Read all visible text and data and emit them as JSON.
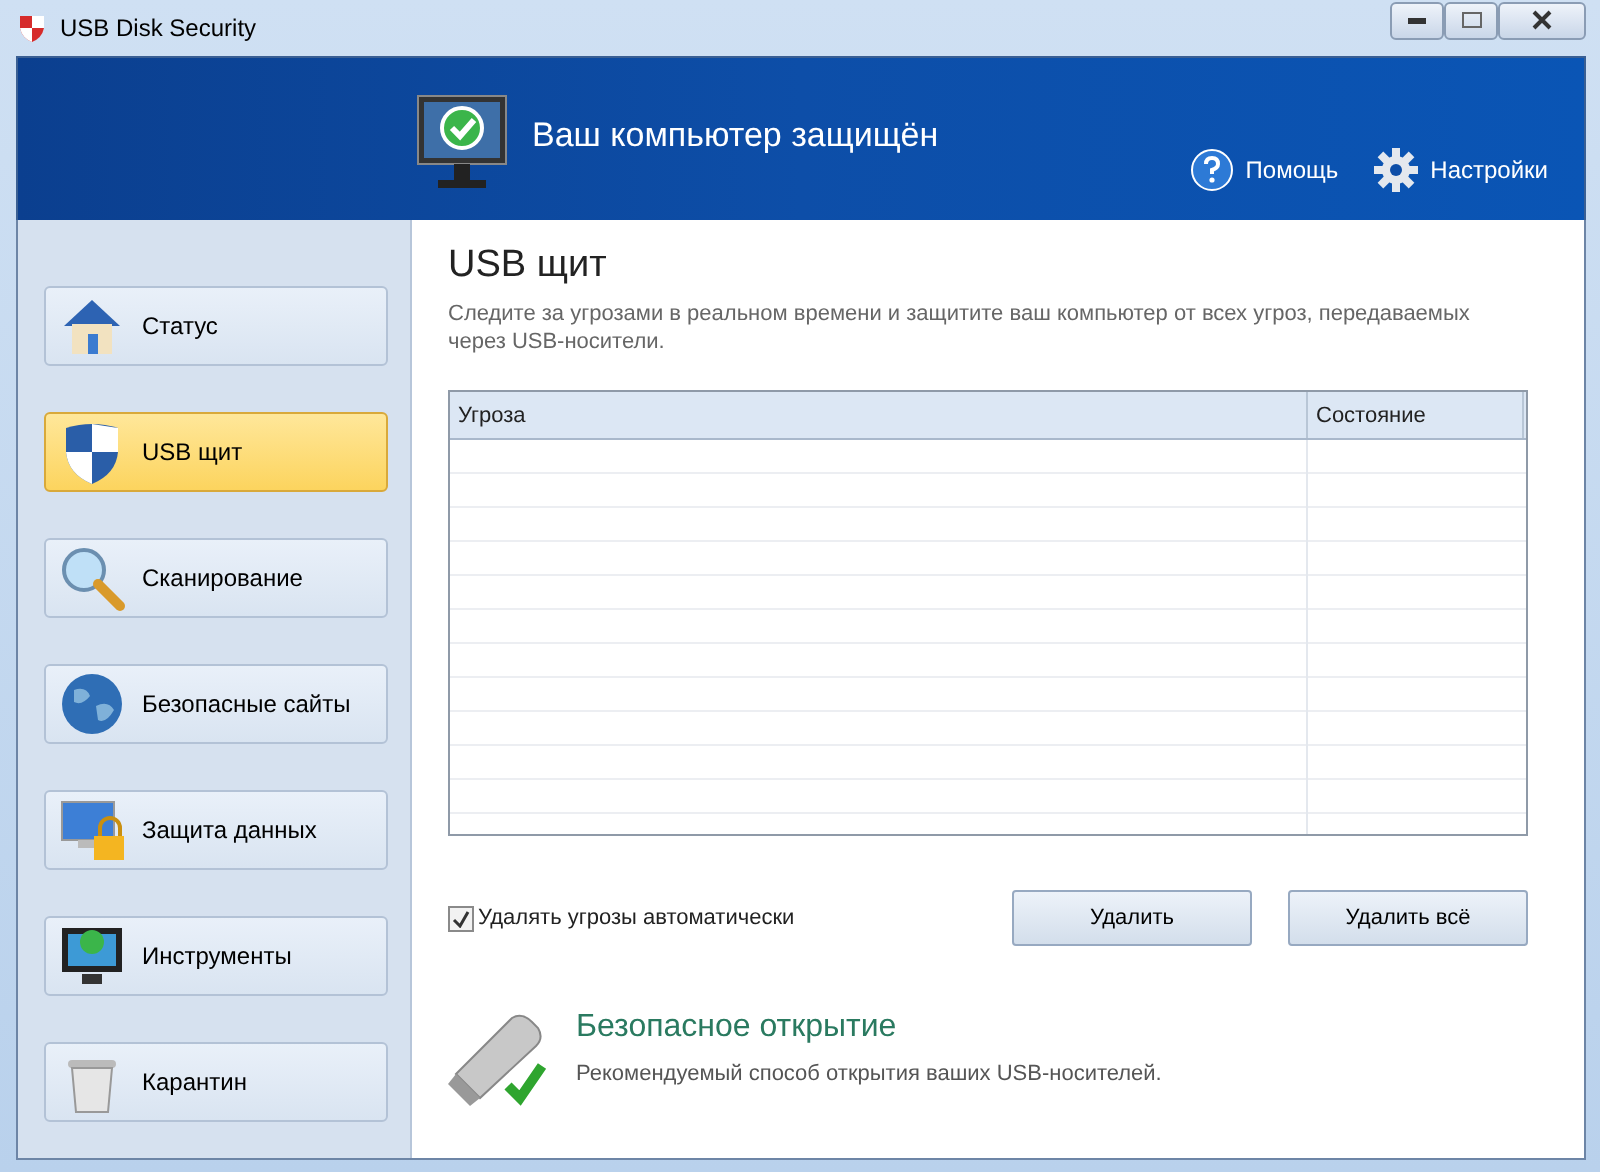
{
  "window": {
    "title": "USB Disk Security"
  },
  "header": {
    "status": "Ваш компьютер защищён",
    "links": [
      {
        "label": "Помощь",
        "kind": "help"
      },
      {
        "label": "Настройки",
        "kind": "settings"
      }
    ]
  },
  "sidebar": {
    "items": [
      {
        "label": "Статус",
        "kind": "house",
        "selected": false
      },
      {
        "label": "USB щит",
        "kind": "shield",
        "selected": true
      },
      {
        "label": "Сканирование",
        "kind": "magnifier",
        "selected": false
      },
      {
        "label": "Безопасные сайты",
        "kind": "globe",
        "selected": false
      },
      {
        "label": "Защита данных",
        "kind": "lock",
        "selected": false
      },
      {
        "label": "Инструменты",
        "kind": "monitor",
        "selected": false
      },
      {
        "label": "Карантин",
        "kind": "trash",
        "selected": false
      }
    ]
  },
  "content": {
    "title": "USB щит",
    "description": "Следите за угрозами в реальном времени и защитите ваш компьютер от всех угроз, передаваемых через USB-носители.",
    "table": {
      "columns": [
        "Угроза",
        "Состояние"
      ]
    },
    "auto_delete": {
      "label": "Удалять угрозы автоматически",
      "checked": true
    },
    "buttons": [
      "Удалить",
      "Удалить всё"
    ],
    "safe_open": {
      "title": "Безопасное открытие",
      "description": "Рекомендуемый способ открытия ваших USB-носителей."
    }
  }
}
